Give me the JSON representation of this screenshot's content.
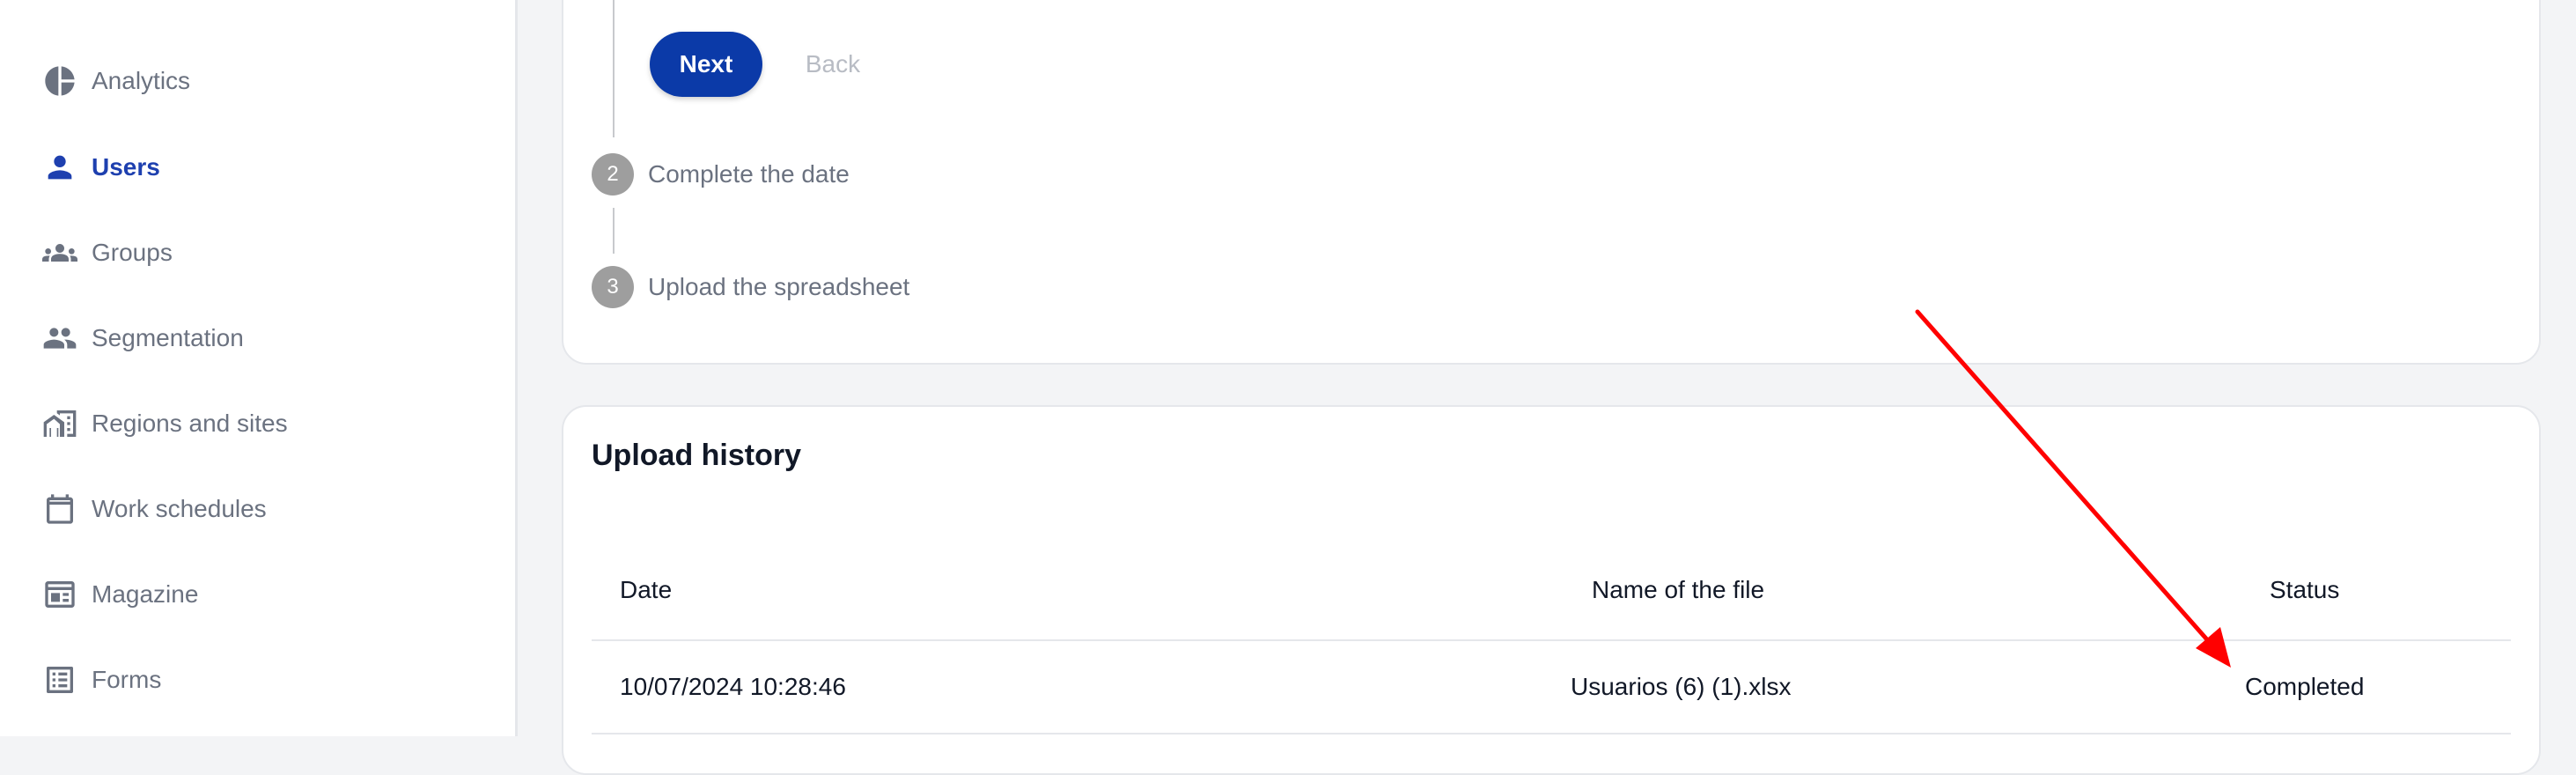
{
  "sidebar": {
    "items": [
      {
        "label": "Analytics",
        "icon": "pie-chart-icon",
        "active": false
      },
      {
        "label": "Users",
        "icon": "person-icon",
        "active": true
      },
      {
        "label": "Groups",
        "icon": "groups-icon",
        "active": false
      },
      {
        "label": "Segmentation",
        "icon": "people-icon",
        "active": false
      },
      {
        "label": "Regions and sites",
        "icon": "home-work-icon",
        "active": false
      },
      {
        "label": "Work schedules",
        "icon": "calendar-icon",
        "active": false
      },
      {
        "label": "Magazine",
        "icon": "newspaper-icon",
        "active": false
      },
      {
        "label": "Forms",
        "icon": "list-form-icon",
        "active": false
      }
    ]
  },
  "stepper": {
    "next_label": "Next",
    "back_label": "Back",
    "steps": [
      {
        "number": "2",
        "label": "Complete the date"
      },
      {
        "number": "3",
        "label": "Upload the spreadsheet"
      }
    ]
  },
  "history": {
    "title": "Upload history",
    "columns": [
      "Date",
      "Name of the file",
      "Status"
    ],
    "rows": [
      {
        "date": "10/07/2024 10:28:46",
        "file": "Usuarios (6) (1).xlsx",
        "status": "Completed"
      }
    ]
  },
  "colors": {
    "accent": "#0b3aa8",
    "active_nav": "#1e40af",
    "inactive_text": "#6b7280",
    "step_circle": "#9e9e9e",
    "annotation": "#ff0000"
  }
}
